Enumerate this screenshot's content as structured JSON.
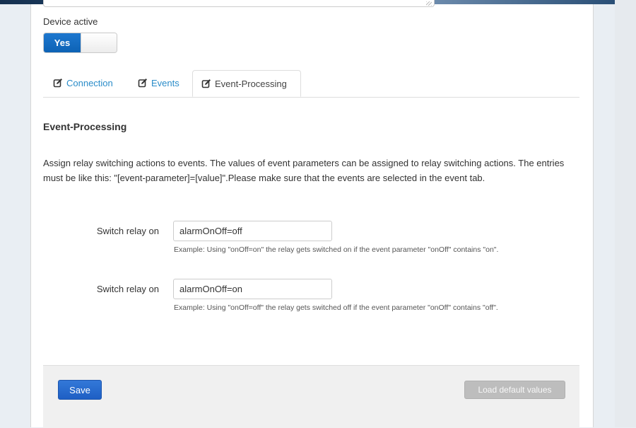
{
  "device": {
    "label": "Device active",
    "toggle_value": "Yes"
  },
  "tabs": [
    {
      "label": "Connection",
      "icon": "edit-icon",
      "active": false
    },
    {
      "label": "Events",
      "icon": "edit-icon",
      "active": false
    },
    {
      "label": "Event-Processing",
      "icon": "edit-icon",
      "active": true
    }
  ],
  "section": {
    "title": "Event-Processing",
    "description": "Assign relay switching actions to events. The values of event parameters can be assigned to relay switching actions. The entries must be like this: \"[event-parameter]=[value]\".Please make sure that the events are selected in the event tab."
  },
  "fields": [
    {
      "label": "Switch relay on",
      "value": "alarmOnOff=off",
      "hint": "Example: Using \"onOff=on\" the relay gets switched on if the event parameter \"onOff\" contains \"on\"."
    },
    {
      "label": "Switch relay on",
      "value": "alarmOnOff=on",
      "hint": "Example: Using \"onOff=off\" the relay gets switched off if the event parameter \"onOff\" contains \"off\"."
    }
  ],
  "footer": {
    "save_label": "Save",
    "load_default_label": "Load default values"
  },
  "colors": {
    "accent": "#1e66c8",
    "tab_link": "#2a8cc9",
    "toggle_on": "#1e78cf",
    "disabled_button": "#bdbdbd"
  }
}
